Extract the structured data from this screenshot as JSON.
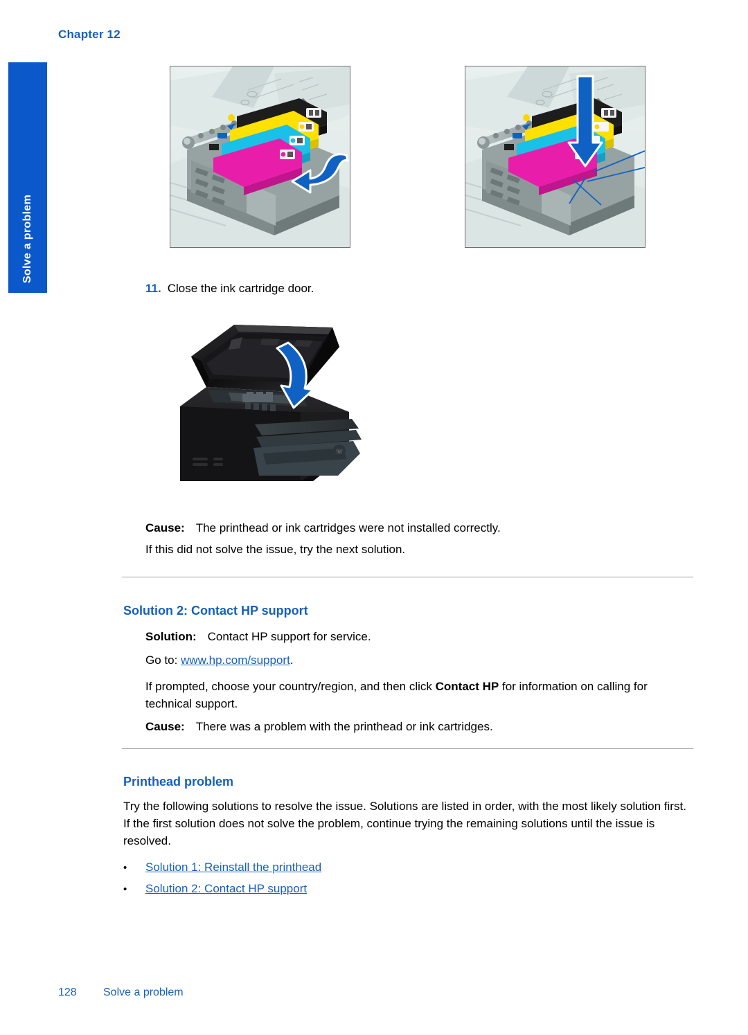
{
  "document": {
    "chapter": "Chapter 12",
    "side_tab_label": "Solve a problem",
    "page_number": "128",
    "footer_section": "Solve a problem"
  },
  "step": {
    "number": "11.",
    "text": "Close the ink cartridge door."
  },
  "figures": [
    {
      "name": "ink-cartridge-carriage-push-figure",
      "caption": "",
      "alt": "Ink cartridge carriage with black, yellow, cyan and magenta cartridges; blue curved arrow pointing left into the carriage"
    },
    {
      "name": "ink-cartridge-carriage-seat-figure",
      "caption": "",
      "alt": "Ink cartridge carriage with blue downward arrow pressing cartridges into place and leader lines to cartridge tabs"
    },
    {
      "name": "printer-close-door-figure",
      "caption": "",
      "alt": "All-in-one printer with ink cartridge door open and blue arrow showing the door closing"
    }
  ],
  "cause_block_1": {
    "label": "Cause:",
    "text": "The printhead or ink cartridges were not installed correctly.",
    "followup": "If this did not solve the issue, try the next solution."
  },
  "solution2": {
    "heading": "Solution 2: Contact HP support",
    "solution_label": "Solution:",
    "solution_text": "Contact HP support for service.",
    "goto_prefix": "Go to: ",
    "goto_link": "www.hp.com/support",
    "goto_suffix": ".",
    "prompt_before": "If prompted, choose your country/region, and then click ",
    "prompt_bold": "Contact HP",
    "prompt_after": " for information on calling for technical support.",
    "cause_label": "Cause:",
    "cause_text": "There was a problem with the printhead or ink cartridges."
  },
  "printhead_problem": {
    "heading": "Printhead problem",
    "body": "Try the following solutions to resolve the issue. Solutions are listed in order, with the most likely solution first. If the first solution does not solve the problem, continue trying the remaining solutions until the issue is resolved.",
    "bullet_marker": "•",
    "links": [
      "Solution 1: Reinstall the printhead",
      "Solution 2: Contact HP support"
    ]
  },
  "colors": {
    "accent_blue": "#1560bd",
    "tab_blue": "#0a58ca",
    "rule_gray": "#9b9b9b",
    "arrow_blue": "#0f62c4",
    "cartridge_black": "#1d1d1d",
    "cartridge_yellow": "#ffe000",
    "cartridge_cyan": "#19c0e8",
    "cartridge_magenta": "#e81eab"
  }
}
